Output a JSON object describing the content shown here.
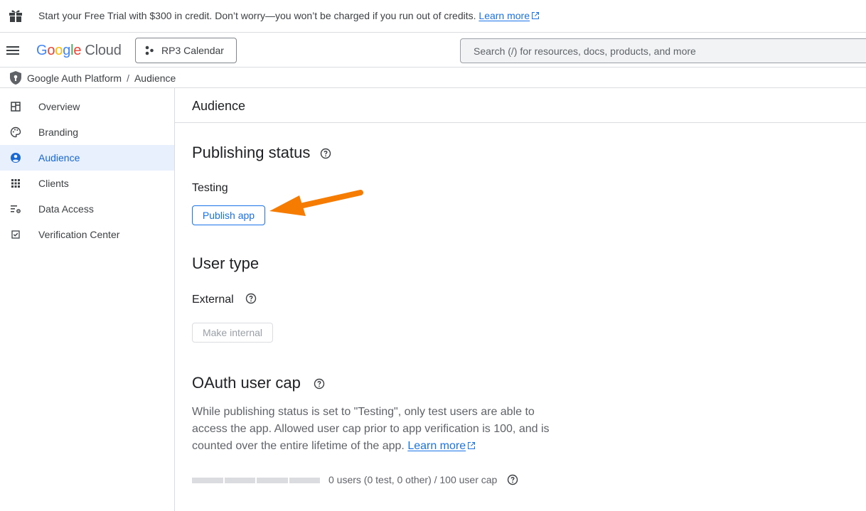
{
  "banner": {
    "text": "Start your Free Trial with $300 in credit. Don’t worry—you won’t be charged if you run out of credits.",
    "link": "Learn more",
    "icon": "gift-icon"
  },
  "header": {
    "logo_google": [
      "G",
      "o",
      "o",
      "g",
      "l",
      "e"
    ],
    "logo_cloud": "Cloud",
    "project": "RP3 Calendar",
    "search_placeholder": "Search (/) for resources, docs, products, and more",
    "brand_colors": {
      "blue": "#4285f4",
      "red": "#ea4335",
      "yellow": "#fbbc04",
      "green": "#34a853"
    }
  },
  "breadcrumb": {
    "root": "Google Auth Platform",
    "separator": "/",
    "current": "Audience"
  },
  "sidebar": {
    "items": [
      {
        "label": "Overview",
        "icon": "dashboard-icon"
      },
      {
        "label": "Branding",
        "icon": "palette-icon"
      },
      {
        "label": "Audience",
        "icon": "account-circle-icon",
        "active": true
      },
      {
        "label": "Clients",
        "icon": "apps-grid-icon"
      },
      {
        "label": "Data Access",
        "icon": "list-settings-icon"
      },
      {
        "label": "Verification Center",
        "icon": "checkbox-icon"
      }
    ],
    "active_color": "#1967d2",
    "active_bg": "#e8f0fe"
  },
  "main": {
    "title": "Audience",
    "publishing": {
      "heading": "Publishing status",
      "status": "Testing",
      "button": "Publish app"
    },
    "user_type": {
      "heading": "User type",
      "value": "External",
      "button": "Make internal"
    },
    "oauth_cap": {
      "heading": "OAuth user cap",
      "description": "While publishing status is set to \"Testing\", only test users are able to access the app. Allowed user cap prior to app verification is 100, and is counted over the entire lifetime of the app.",
      "link": "Learn more",
      "usage_text": "0 users (0 test, 0 other) / 100 user cap",
      "used": 0,
      "cap": 100
    }
  },
  "annotation": {
    "arrow_color": "#f57c00"
  }
}
